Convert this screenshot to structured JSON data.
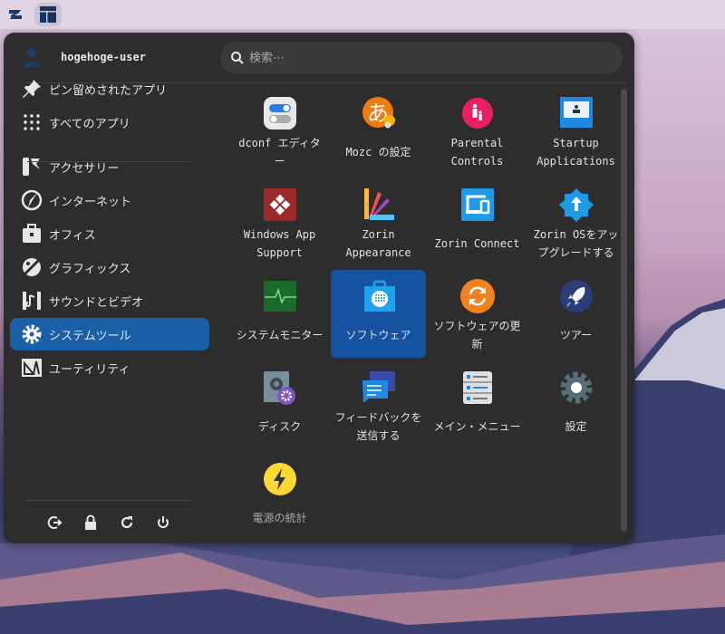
{
  "topbar": {
    "logo": "zorin-logo-icon",
    "active_app": "menu-layout-icon"
  },
  "user": {
    "name": "hogehoge-user"
  },
  "search": {
    "placeholder": "検索⋯",
    "value": ""
  },
  "sidebar": {
    "items": [
      {
        "label": "ピン留めされたアプリ",
        "icon": "pin-icon"
      },
      {
        "label": "すべてのアプリ",
        "icon": "grid-icon"
      },
      {
        "label": "アクセサリー",
        "icon": "accessories-icon"
      },
      {
        "label": "インターネット",
        "icon": "internet-icon"
      },
      {
        "label": "オフィス",
        "icon": "office-icon"
      },
      {
        "label": "グラフィックス",
        "icon": "graphics-icon"
      },
      {
        "label": "サウンドとビデオ",
        "icon": "sound-video-icon"
      },
      {
        "label": "システムツール",
        "icon": "gear-icon",
        "selected": true
      },
      {
        "label": "ユーティリティ",
        "icon": "utilities-icon"
      }
    ],
    "power_buttons": [
      "logout-icon",
      "lock-icon",
      "restart-icon",
      "power-icon"
    ]
  },
  "apps": [
    {
      "label": "dconf エディター",
      "icon": "dconf"
    },
    {
      "label": "Mozc の設定",
      "icon": "mozc"
    },
    {
      "label": "Parental Controls",
      "icon": "parental"
    },
    {
      "label": "Startup Applications",
      "icon": "startup"
    },
    {
      "label": "Windows App Support",
      "icon": "wine"
    },
    {
      "label": "Zorin Appearance",
      "icon": "appearance"
    },
    {
      "label": "Zorin Connect",
      "icon": "connect"
    },
    {
      "label": "Zorin OSをアップグレードする",
      "icon": "upgrade"
    },
    {
      "label": "システムモニター",
      "icon": "monitor"
    },
    {
      "label": "ソフトウェア",
      "icon": "software",
      "selected": true
    },
    {
      "label": "ソフトウェアの更新",
      "icon": "update"
    },
    {
      "label": "ツアー",
      "icon": "tour"
    },
    {
      "label": "ディスク",
      "icon": "disk"
    },
    {
      "label": "フィードバックを送信する",
      "icon": "feedback"
    },
    {
      "label": "メイン・メニュー",
      "icon": "mainmenu"
    },
    {
      "label": "設定",
      "icon": "settings"
    },
    {
      "label": "電源の統計",
      "icon": "power-stats",
      "dim": true
    }
  ],
  "colors": {
    "selected": "#1b5fa6",
    "panel": "#2d2d2d"
  }
}
